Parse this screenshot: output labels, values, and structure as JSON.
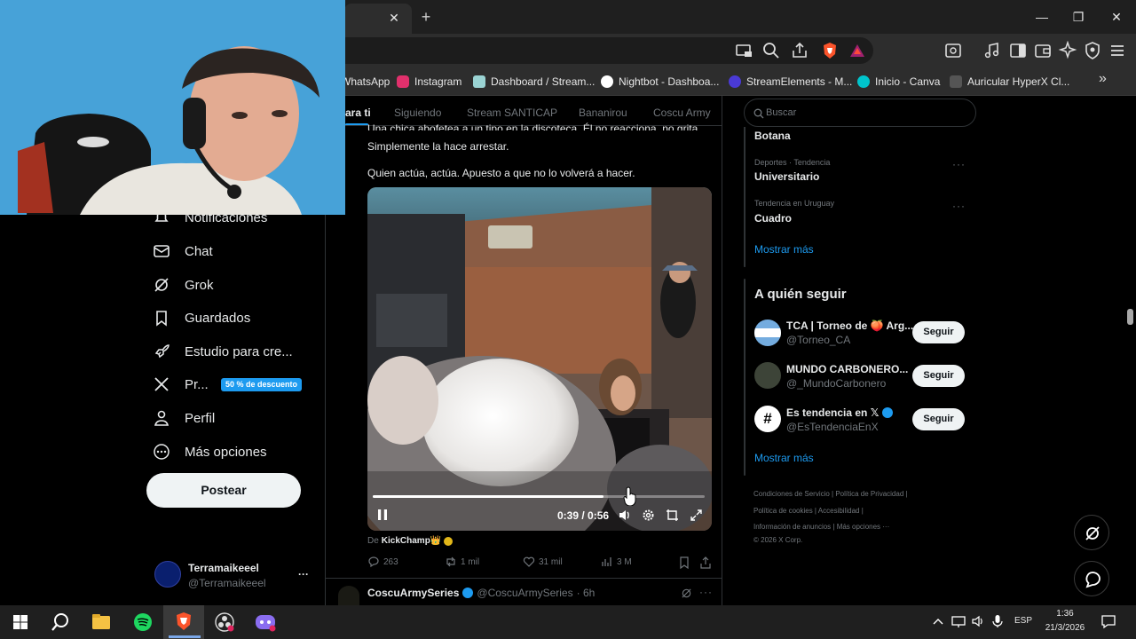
{
  "browser": {
    "tab_close": "✕",
    "new_tab": "+",
    "window": {
      "minimize": "—",
      "restore": "❐",
      "close": "✕"
    },
    "bookmarks": [
      {
        "label": "WhatsApp",
        "color": "#25d366"
      },
      {
        "label": "Instagram",
        "color": "#e1306c"
      },
      {
        "label": "Dashboard / Stream...",
        "color": "#9ad3d3"
      },
      {
        "label": "Nightbot - Dashboa...",
        "color": "#ffffff"
      },
      {
        "label": "StreamElements - M...",
        "color": "#4a3ad6"
      },
      {
        "label": "Inicio - Canva",
        "color": "#00c4cc"
      },
      {
        "label": "Auricular HyperX Cl...",
        "color": "#555555"
      }
    ],
    "bookmarks_more": "»"
  },
  "sidebar": {
    "items": [
      {
        "label": "Notificaciones",
        "icon": "bell-icon"
      },
      {
        "label": "Chat",
        "icon": "mail-icon"
      },
      {
        "label": "Grok",
        "icon": "grok-icon"
      },
      {
        "label": "Guardados",
        "icon": "bookmark-icon"
      },
      {
        "label": "Estudio para cre...",
        "icon": "rocket-icon"
      },
      {
        "label": "Pr...",
        "icon": "x-logo-icon"
      },
      {
        "label": "Perfil",
        "icon": "person-icon"
      },
      {
        "label": "Más opciones",
        "icon": "more-circle-icon"
      }
    ],
    "premium_badge": "50 % de descuento",
    "post_button": "Postear",
    "account": {
      "name": "Terramaikeeel",
      "handle": "@Terramaikeeel",
      "more": "···"
    }
  },
  "feed": {
    "tabs": [
      "ara ti",
      "Siguiendo",
      "Stream SANTICAP",
      "Bananirou",
      "Coscu Army"
    ],
    "tweet": {
      "text_line1": "Una chica abofetea a un tipo en la discoteca. Él no reacciona, no grita.",
      "text_line2": "Simplemente la hace arrestar.",
      "text_line3": "Quien actúa, actúa. Apuesto a que no lo volverá a hacer.",
      "video": {
        "time": "0:39 / 0:56",
        "progress": 0.696
      },
      "source_prefix": "De",
      "source_name": "KickChamp👑",
      "replies": "263",
      "reposts": "1 mil",
      "likes": "31 mil",
      "views": "3 M"
    },
    "next_tweet": {
      "name": "CoscuArmySeries",
      "handle": "@CoscuArmySeries",
      "time": "· 6h"
    }
  },
  "right": {
    "search_placeholder": "Buscar",
    "trends": [
      {
        "category": "",
        "name": "Botana"
      },
      {
        "category": "Deportes · Tendencia",
        "name": "Universitario"
      },
      {
        "category": "Tendencia en Uruguay",
        "name": "Cuadro"
      }
    ],
    "trends_more": "Mostrar más",
    "who_to_follow_title": "A quién seguir",
    "follow": [
      {
        "name": "TCA | Torneo de 🍑 Arg...",
        "handle": "@Torneo_CA",
        "button": "Seguir"
      },
      {
        "name": "MUNDO CARBONERO...",
        "handle": "@_MundoCarbonero",
        "button": "Seguir"
      },
      {
        "name": "Es tendencia en 𝕏",
        "handle": "@EsTendenciaEnX",
        "button": "Seguir"
      }
    ],
    "follow_more": "Mostrar más",
    "footer": {
      "line1": "Condiciones de Servicio  |  Política de Privacidad  |",
      "line2": "Política de cookies  |  Accesibilidad  |",
      "line3": "Información de anuncios  |  Más opciones ···",
      "line4": "© 2026 X Corp."
    },
    "dots": "···"
  },
  "taskbar": {
    "lang": "ESP",
    "time": "1:36",
    "date": "21/3/2026"
  }
}
